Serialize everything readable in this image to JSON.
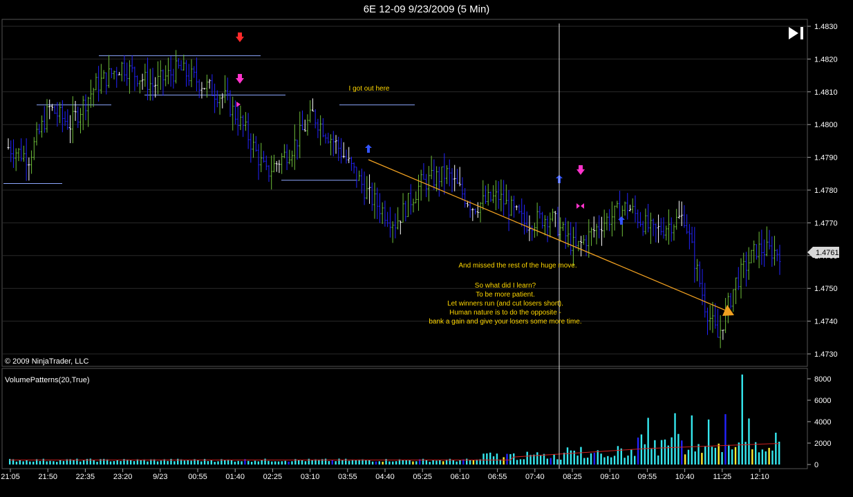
{
  "window_title": "6E 12-09  9/23/2009 (5 Min)",
  "copyright": "© 2009 NinjaTrader, LLC",
  "indicator_label": "VolumePatterns(20,True)",
  "last_price_label": "1.4761",
  "icons": {
    "play_to_end": "skip-to-end-icon",
    "down_arrow": "red-down-arrow-icon",
    "up_arrow": "blue-up-arrow-icon",
    "magenta_arrow": "magenta-arrow-icon"
  },
  "colors": {
    "background": "#000000",
    "grid": "#2a2a2a",
    "up_bar": "#6fbf3a",
    "down_bar": "#2323ff",
    "neutral_bar": "#ffffff",
    "level_line": "#8ea8ff",
    "trendline": "#f0a020",
    "annotation": "#ffd700",
    "volume_bar": "#35e8f0",
    "volume_low": "#ffee33",
    "volume_avg": "#d02020"
  },
  "annotations": {
    "got_out": "I got out here",
    "missed": "And missed the rest of the huge move.",
    "lesson_lines": [
      "So what did I learn?",
      "To be more patient.",
      "Let winners run (and cut losers short).",
      "Human nature is to do the opposite -",
      "bank a gain and give your losers some more time."
    ]
  },
  "chart_data": [
    {
      "type": "ohlc",
      "title": "6E 12-09  9/23/2009 (5 Min)",
      "ylim": [
        1.4725,
        1.4833
      ],
      "y_ticks": [
        "1.4830",
        "1.4820",
        "1.4810",
        "1.4800",
        "1.4790",
        "1.4780",
        "1.4770",
        "1.4760",
        "1.4750",
        "1.4740",
        "1.4730"
      ],
      "x_ticks": [
        "21:05",
        "21:50",
        "22:35",
        "23:20",
        "9/23",
        "00:55",
        "01:40",
        "02:25",
        "03:10",
        "03:55",
        "04:40",
        "05:25",
        "06:10",
        "06:55",
        "07:40",
        "08:25",
        "09:10",
        "09:55",
        "10:40",
        "11:25",
        "12:10"
      ],
      "bars": 180,
      "last_price": 1.4761,
      "open_approx": 1.4794,
      "high_approx": 1.4824,
      "low_approx": 1.473,
      "close_approx": 1.4761
    },
    {
      "type": "bar",
      "title": "VolumePatterns(20,True)",
      "ylim": [
        0,
        8500
      ],
      "y_ticks": [
        "8000",
        "6000",
        "4000",
        "2000",
        "0"
      ],
      "peak_volume": 8400
    }
  ]
}
